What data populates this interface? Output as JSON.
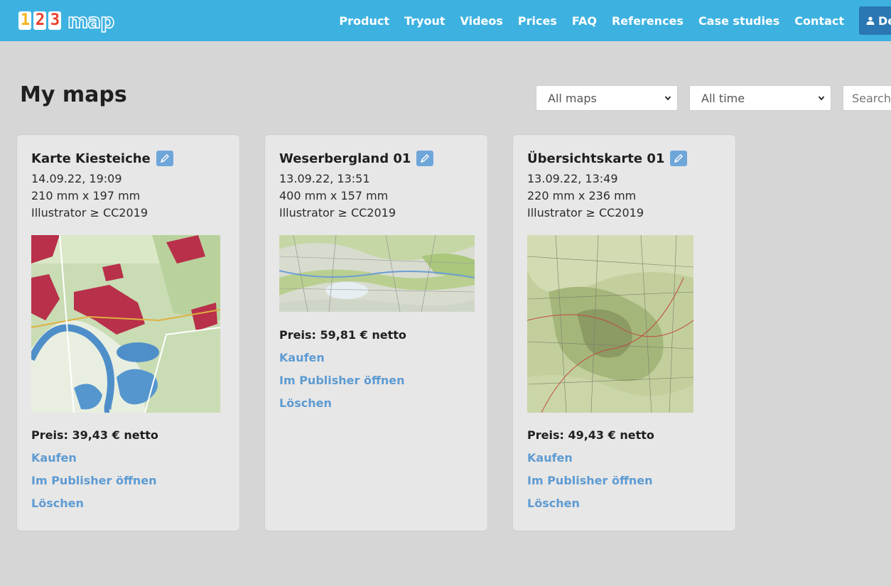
{
  "header": {
    "logo": {
      "digits": [
        "1",
        "2",
        "3"
      ],
      "word": "map"
    },
    "nav": [
      "Product",
      "Tryout",
      "Videos",
      "Prices",
      "FAQ",
      "References",
      "Case studies",
      "Contact"
    ],
    "user_button": "De"
  },
  "page": {
    "title": "My maps",
    "filter_maps": "All maps",
    "filter_time": "All time",
    "search_placeholder": "Search"
  },
  "colors": {
    "header_bg": "#3db2e1",
    "link": "#5e9bd1",
    "edit_badge": "#6fa6da"
  },
  "maps": [
    {
      "title": "Karte Kiesteiche",
      "date": "14.09.22, 19:09",
      "size": "210 mm x 197 mm",
      "format": "Illustrator ≥ CC2019",
      "price": "Preis: 39,43 € netto",
      "buy": "Kaufen",
      "open": "Im Publisher öffnen",
      "delete": "Löschen"
    },
    {
      "title": "Weserbergland 01",
      "date": "13.09.22, 13:51",
      "size": "400 mm x 157 mm",
      "format": "Illustrator ≥ CC2019",
      "price": "Preis: 59,81 € netto",
      "buy": "Kaufen",
      "open": "Im Publisher öffnen",
      "delete": "Löschen"
    },
    {
      "title": "Übersichtskarte 01",
      "date": "13.09.22, 13:49",
      "size": "220 mm x 236 mm",
      "format": "Illustrator ≥ CC2019",
      "price": "Preis: 49,43 € netto",
      "buy": "Kaufen",
      "open": "Im Publisher öffnen",
      "delete": "Löschen"
    }
  ]
}
